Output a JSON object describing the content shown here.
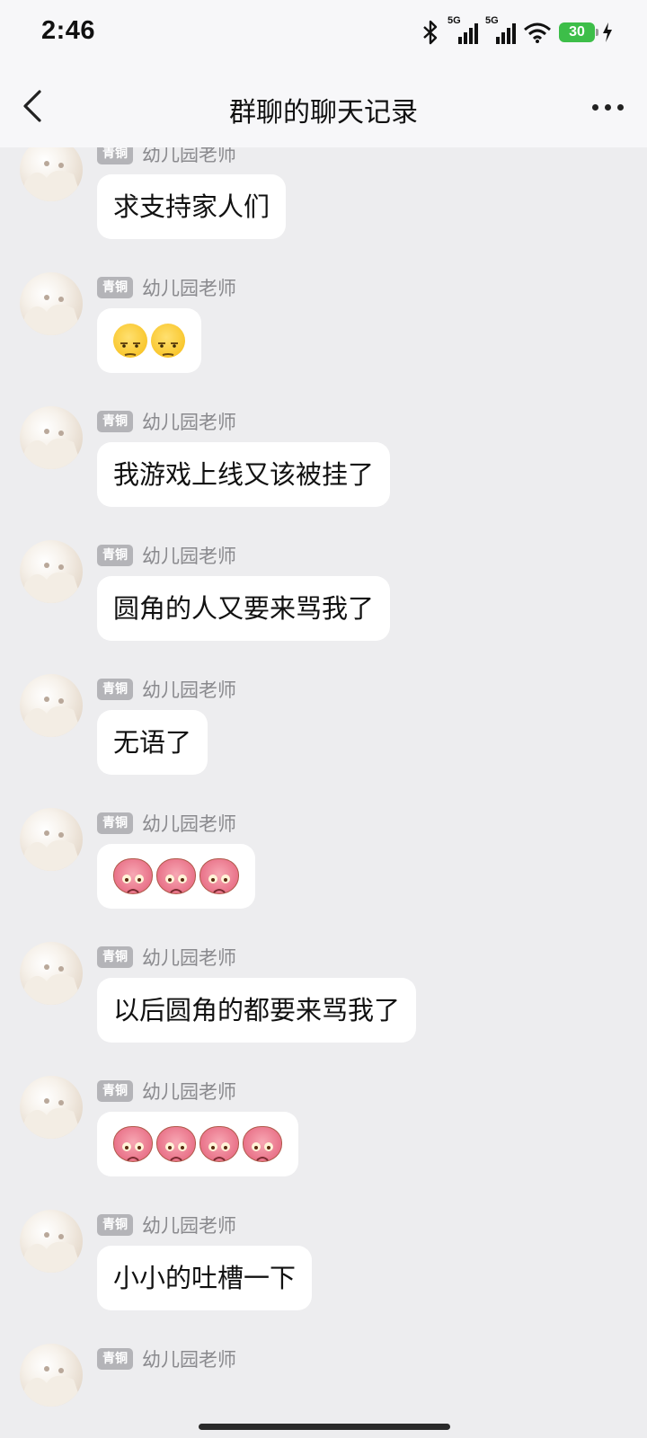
{
  "status_bar": {
    "time": "2:46",
    "signal_1_label": "5G",
    "signal_2_label": "5G",
    "battery_level": "30",
    "icons": [
      "bluetooth-icon",
      "signal-icon",
      "signal-icon",
      "wifi-icon",
      "battery-icon",
      "charging-icon"
    ]
  },
  "header": {
    "title": "群聊的聊天记录",
    "back_icon": "chevron-left-icon",
    "more_icon": "more-dots-icon"
  },
  "messages": [
    {
      "badge": "青铜",
      "sender": "幼儿园老师",
      "text": "求支持家人们"
    },
    {
      "badge": "青铜",
      "sender": "幼儿园老师",
      "emoji": "smirk",
      "count": 2
    },
    {
      "badge": "青铜",
      "sender": "幼儿园老师",
      "text": "我游戏上线又该被挂了"
    },
    {
      "badge": "青铜",
      "sender": "幼儿园老师",
      "text": "圆角的人又要来骂我了"
    },
    {
      "badge": "青铜",
      "sender": "幼儿园老师",
      "text": "无语了"
    },
    {
      "badge": "青铜",
      "sender": "幼儿园老师",
      "emoji": "sad",
      "count": 3
    },
    {
      "badge": "青铜",
      "sender": "幼儿园老师",
      "text": "以后圆角的都要来骂我了"
    },
    {
      "badge": "青铜",
      "sender": "幼儿园老师",
      "emoji": "sad",
      "count": 4
    },
    {
      "badge": "青铜",
      "sender": "幼儿园老师",
      "text": "小小的吐槽一下"
    },
    {
      "badge": "青铜",
      "sender": "幼儿园老师"
    }
  ],
  "colors": {
    "background": "#EDEDEF",
    "bubble": "#FFFFFF",
    "badge": "#B4B4B8",
    "battery": "#3DBE49"
  }
}
